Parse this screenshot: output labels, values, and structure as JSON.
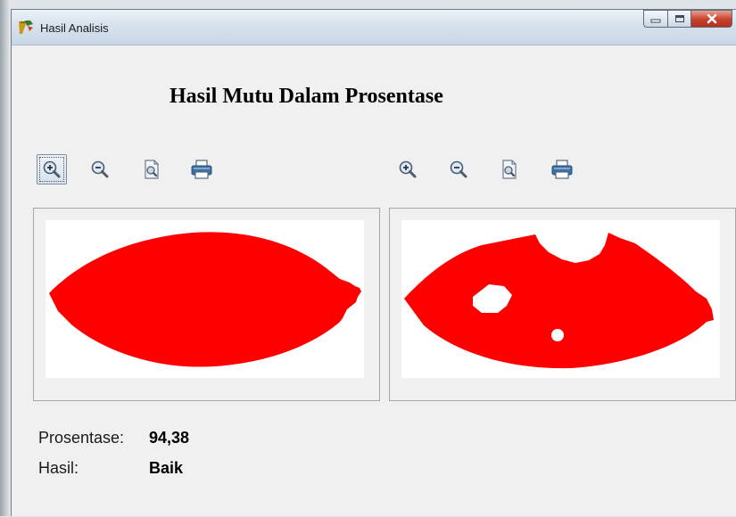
{
  "window": {
    "title": "Hasil Analisis",
    "icon": "app-icon",
    "controls": [
      "minimize-icon",
      "maximize-icon",
      "close-icon"
    ]
  },
  "heading": "Hasil Mutu Dalam Prosentase",
  "toolbars": {
    "left": [
      "zoom-in-icon",
      "zoom-out-icon",
      "zoom-page-icon",
      "printer-icon"
    ],
    "right": [
      "zoom-in-icon",
      "zoom-out-icon",
      "zoom-page-icon",
      "printer-icon"
    ]
  },
  "results": {
    "percentage_label": "Prosentase:",
    "percentage_value": "94,38",
    "result_label": "Hasil:",
    "result_value": "Baik"
  },
  "colors": {
    "mask": "#ff0000",
    "canvas_bg": "#ffffff",
    "window_bg": "#f0f0f0"
  }
}
